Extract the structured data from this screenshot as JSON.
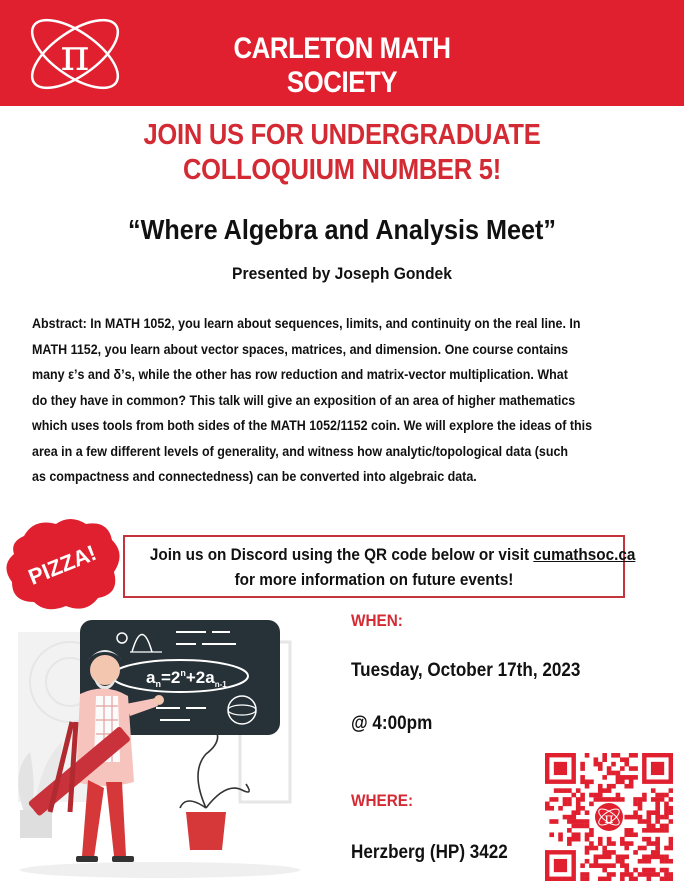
{
  "header": {
    "title": "CARLETON MATH SOCIETY",
    "logo_icon": "pi-atom-logo-icon"
  },
  "headline": {
    "line1": "JOIN US FOR UNDERGRADUATE",
    "line2": "COLLOQUIUM NUMBER 5!"
  },
  "talk": {
    "title": "“Where Algebra and Analysis Meet”",
    "presenter": "Presented by Joseph Gondek"
  },
  "abstract": {
    "lines": [
      "Abstract: In MATH 1052, you learn about sequences, limits, and continuity on the real line. In",
      "MATH 1152, you learn about vector spaces, matrices, and dimension. One course contains",
      "many ε’s and δ’s, while the other has row reduction and matrix-vector multiplication. What",
      "do they have in common? This talk will give an exposition of an area of higher mathematics",
      "which uses tools from both sides of the MATH 1052/1152 coin. We will explore the ideas of this",
      "area in a few different levels of generality, and witness how analytic/topological data (such",
      "as compactness and connectedness) can be converted into algebraic data."
    ]
  },
  "pizza_badge": "PIZZA!",
  "discord": {
    "text_before": "Join us on Discord using the QR code below or visit ",
    "link": "cumathsoc.ca",
    "line2": "for more information on future events!"
  },
  "event": {
    "when_label": "WHEN:",
    "date": "Tuesday, October 17th, 2023",
    "time": "@ 4:00pm",
    "where_label": "WHERE:",
    "location": "Herzberg (HP) 3422"
  },
  "chalkboard": {
    "formula_a": "a",
    "formula_n": "n",
    "formula_mid": "=2",
    "formula_sup": "n",
    "formula_plus": "+2a",
    "formula_sub": "n-1"
  },
  "colors": {
    "brand_red": "#e0202f",
    "text_red": "#d42a34",
    "board": "#263238"
  }
}
